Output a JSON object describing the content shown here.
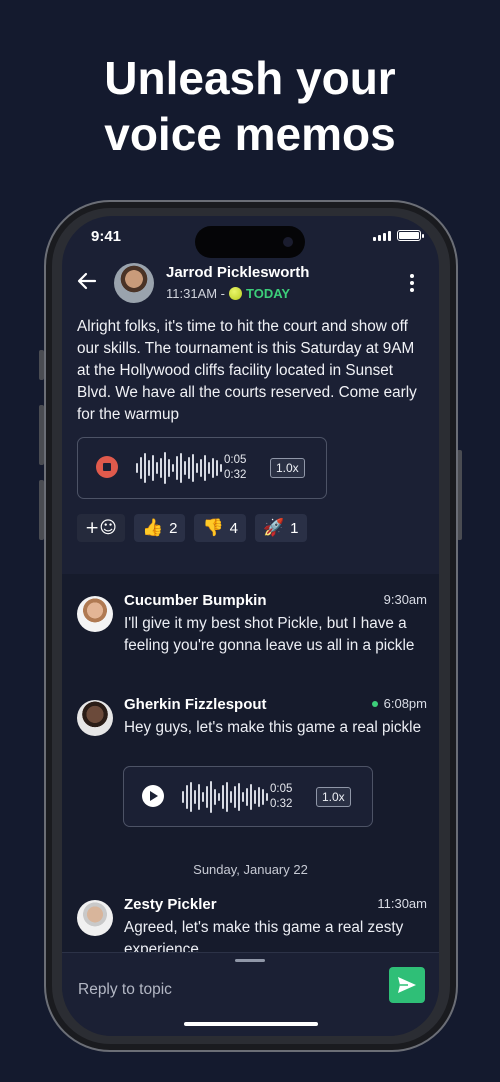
{
  "headline": [
    "Unleash your",
    "voice memos"
  ],
  "status_bar": {
    "time": "9:41"
  },
  "header": {
    "author": "Jarrod Picklesworth",
    "time": "11:31AM -",
    "badge": "TODAY"
  },
  "post": {
    "text": "Alright folks, it's time to hit the court and show off our skills. The tournament is this Saturday at 9AM at the Hollywood cliffs facility located in Sunset Blvd. We have all the courts reserved. Come early for the warmup",
    "audio": {
      "elapsed": "0:05",
      "duration": "0:32",
      "speed": "1.0x",
      "state": "recording-stop"
    }
  },
  "reactions": [
    {
      "emoji": "+☺",
      "count": ""
    },
    {
      "emoji": "👍",
      "count": "2"
    },
    {
      "emoji": "👎",
      "count": "4"
    },
    {
      "emoji": "🚀",
      "count": "1"
    }
  ],
  "messages": [
    {
      "author": "Cucumber Bumpkin",
      "time": "9:30am",
      "online": false,
      "text": "I'll give it my best shot Pickle, but I have a feeling you're gonna leave us all in a pickle"
    },
    {
      "author": "Gherkin Fizzlespout",
      "time": "6:08pm",
      "online": true,
      "text": "Hey guys, let's make this game a real pickle",
      "audio": {
        "elapsed": "0:05",
        "duration": "0:32",
        "speed": "1.0x",
        "state": "play"
      }
    },
    {
      "author": "Zesty Pickler",
      "time": "11:30am",
      "online": false,
      "text": "Agreed, let's make this game a real zesty experience"
    }
  ],
  "date_separator": "Sunday, January 22",
  "composer": {
    "placeholder": "Reply to topic"
  },
  "colors": {
    "background": "#141a2e",
    "accent_green": "#2fbf77",
    "stop_red": "#e05a4c"
  }
}
